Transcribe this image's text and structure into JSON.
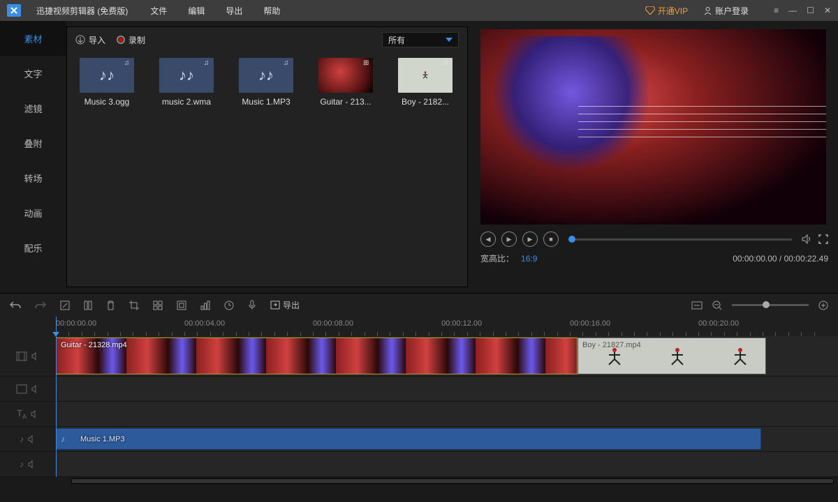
{
  "app": {
    "title": "迅捷视频剪辑器 (免费版)"
  },
  "menu": [
    "文件",
    "编辑",
    "导出",
    "帮助"
  ],
  "header": {
    "vip": "开通VIP",
    "login": "账户登录"
  },
  "sidenav": [
    "素材",
    "文字",
    "滤镜",
    "叠附",
    "转场",
    "动画",
    "配乐"
  ],
  "mediaToolbar": {
    "import": "导入",
    "record": "录制",
    "filter": "所有"
  },
  "media": [
    {
      "name": "Music 3.ogg",
      "kind": "audio"
    },
    {
      "name": "music 2.wma",
      "kind": "audio"
    },
    {
      "name": "Music 1.MP3",
      "kind": "audio"
    },
    {
      "name": "Guitar - 213...",
      "kind": "video-guitar"
    },
    {
      "name": "Boy - 2182...",
      "kind": "video-boy"
    }
  ],
  "preview": {
    "ratioLabel": "宽高比：",
    "ratioValue": "16:9",
    "timecode": "00:00:00.00 / 00:00:22.49"
  },
  "tlToolbar": {
    "export": "导出"
  },
  "ruler": [
    "00:00:00.00",
    "00:00:04.00",
    "00:00:08.00",
    "00:00:12.00",
    "00:00:16.00",
    "00:00:20.00"
  ],
  "clips": {
    "video1": "Guitar - 21328.mp4",
    "video2": "Boy - 21827.mp4",
    "audio": "Music 1.MP3"
  }
}
